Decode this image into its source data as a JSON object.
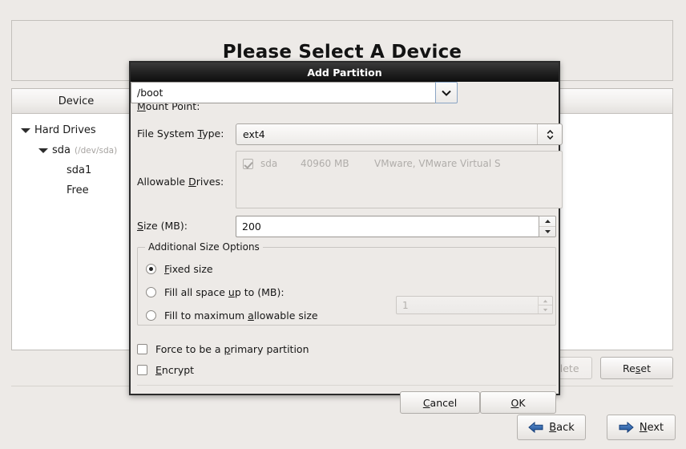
{
  "background": {
    "page_title": "Please Select A Device",
    "device_column_header": "Device",
    "tree": [
      {
        "label": "Hard Drives",
        "sub": "",
        "indent": 10,
        "arrow": "expanded-arrow"
      },
      {
        "label": "sda",
        "sub": "(/dev/sda)",
        "indent": 32,
        "arrow": "expanded-arrow"
      },
      {
        "label": "sda1",
        "sub": "",
        "indent": 68,
        "arrow": "none"
      },
      {
        "label": "Free",
        "sub": "",
        "indent": 68,
        "arrow": "none"
      }
    ],
    "actions": {
      "delete_label": "Delete",
      "delete_visible_text": "ete",
      "delete_disabled": true,
      "reset_label": "Reset",
      "reset_mnemonic": "s"
    },
    "navigation": {
      "back_label": "Back",
      "back_mnemonic": "B",
      "next_label": "Next",
      "next_mnemonic": "N",
      "arrow_color": "#2b5fa8"
    }
  },
  "dialog": {
    "title": "Add Partition",
    "mount_point": {
      "label": "Mount Point:",
      "mnemonic": "M",
      "value": "/boot",
      "dropdown_icon": "chevron-down-icon"
    },
    "filesystem": {
      "label": "File System Type:",
      "mnemonic": "T",
      "value": "ext4",
      "spinner_icon": "up-down-chevron-icon"
    },
    "allowable_drives": {
      "label": "Allowable Drives:",
      "mnemonic": "D",
      "rows": [
        {
          "checked": true,
          "name": "sda",
          "size": "40960 MB",
          "model": "VMware, VMware Virtual S"
        }
      ]
    },
    "size": {
      "label": "Size (MB):",
      "mnemonic": "S",
      "value": "200"
    },
    "additional_size_options": {
      "legend": "Additional Size Options",
      "options": [
        {
          "label": "Fixed size",
          "mnemonic": "F",
          "selected": true
        },
        {
          "label": "Fill all space up to (MB):",
          "mnemonic": "u",
          "selected": false
        },
        {
          "label": "Fill to maximum allowable size",
          "mnemonic": "a",
          "selected": false
        }
      ],
      "fill_upto_value": "1",
      "fill_upto_disabled": true
    },
    "checkboxes": [
      {
        "label": "Force to be a primary partition",
        "mnemonic": "p",
        "checked": false
      },
      {
        "label": "Encrypt",
        "mnemonic": "E",
        "checked": false
      }
    ],
    "buttons": {
      "cancel_label": "Cancel",
      "cancel_mnemonic": "C",
      "ok_label": "OK",
      "ok_mnemonic": "O"
    }
  }
}
